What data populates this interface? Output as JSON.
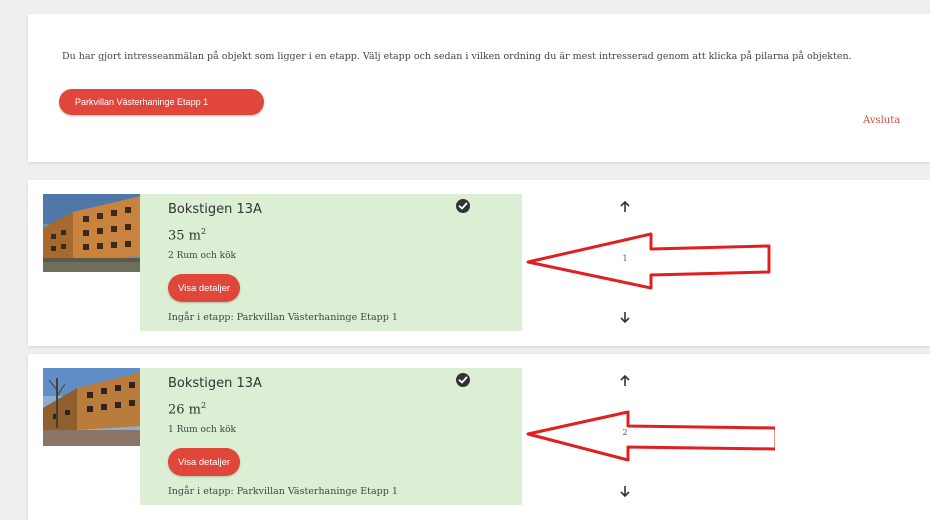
{
  "info": {
    "text": "Du har gjort intresseanmälan på objekt som ligger i en etapp. Välj etapp och sedan i vilken ordning du är mest intresserad genom att klicka på pilarna på objekten.",
    "etapp_button": "Parkvillan Västerhaninge Etapp 1",
    "avsluta": "Avsluta"
  },
  "objects": [
    {
      "title": "Bokstigen 13A",
      "area": "35 m",
      "area_unit_sup": "2",
      "rooms": "2 Rum och kök",
      "details_button": "Visa detaljer",
      "etapp": "Ingår i etapp: Parkvillan Västerhaninge Etapp 1",
      "order": "1",
      "icons": [
        "check-circle-icon",
        "arrow-up-icon",
        "arrow-down-icon"
      ]
    },
    {
      "title": "Bokstigen 13A",
      "area": "26 m",
      "area_unit_sup": "2",
      "rooms": "1 Rum och kök",
      "details_button": "Visa detaljer",
      "etapp": "Ingår i etapp: Parkvillan Västerhaninge Etapp 1",
      "order": "2",
      "icons": [
        "check-circle-icon",
        "arrow-up-icon",
        "arrow-down-icon"
      ]
    }
  ],
  "colors": {
    "accent": "#e0463a",
    "panel": "#dcefd4",
    "annotation": "#e02020"
  }
}
